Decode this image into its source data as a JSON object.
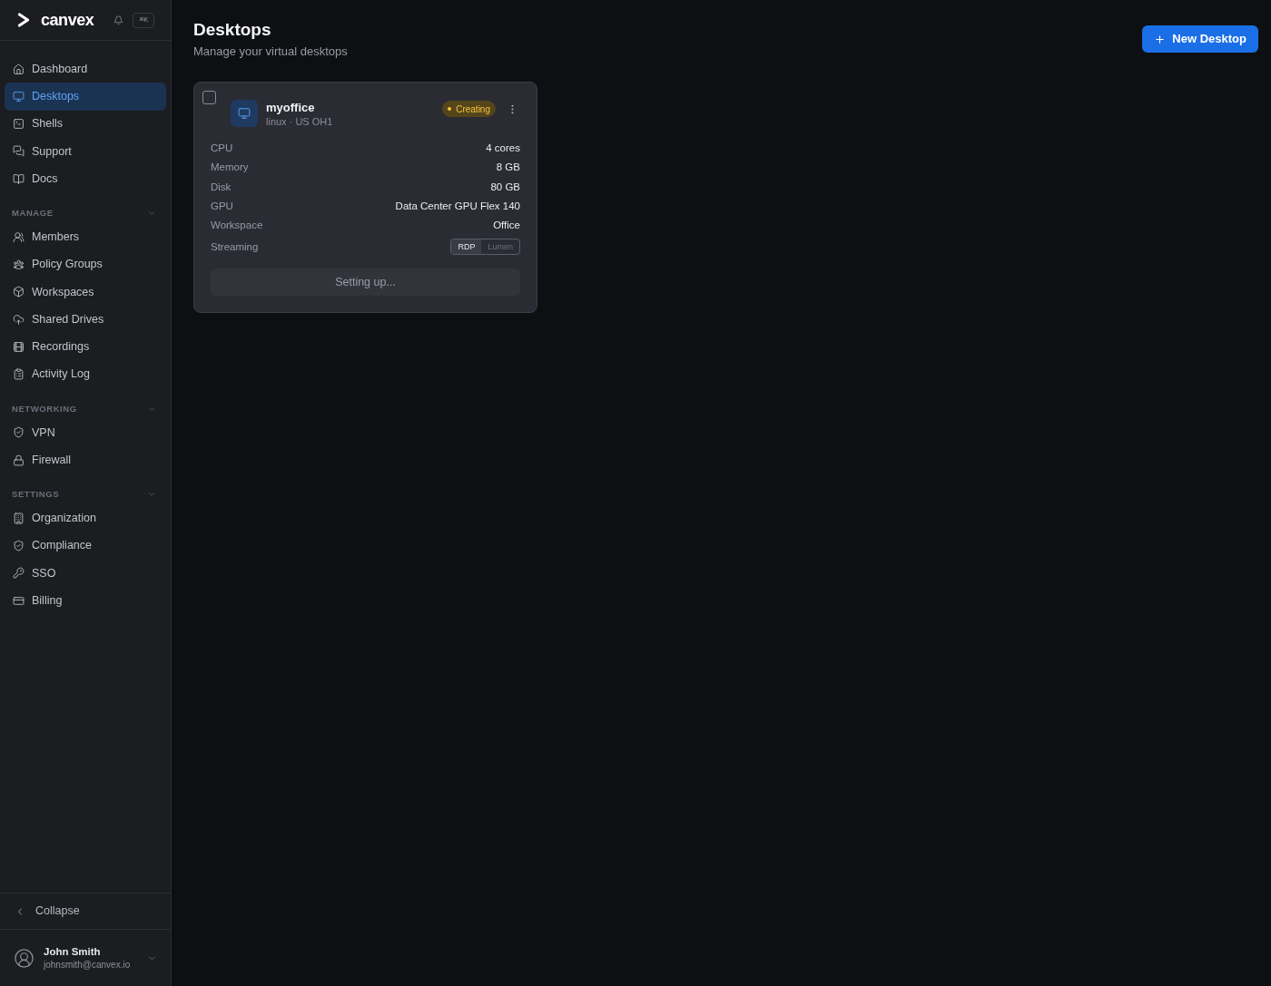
{
  "sidebar": {
    "logo": "canvex",
    "shortcut": "⌘K",
    "nav": [
      {
        "label": "Dashboard",
        "selected": false
      },
      {
        "label": "Desktops",
        "selected": true
      },
      {
        "label": "Shells",
        "selected": false
      },
      {
        "label": "Support",
        "selected": false
      },
      {
        "label": "Docs",
        "selected": false
      }
    ],
    "sections": [
      {
        "title": "MANAGE",
        "expanded": true,
        "items": [
          {
            "label": "Members",
            "selected": false
          },
          {
            "label": "Policy Groups",
            "selected": false
          },
          {
            "label": "Workspaces",
            "selected": false
          },
          {
            "label": "Shared Drives",
            "selected": false
          },
          {
            "label": "Recordings",
            "selected": false
          },
          {
            "label": "Activity Log",
            "selected": false
          }
        ]
      },
      {
        "title": "NETWORKING",
        "expanded": true,
        "items": [
          {
            "label": "VPN",
            "selected": false
          },
          {
            "label": "Firewall",
            "selected": false
          }
        ]
      },
      {
        "title": "SETTINGS",
        "expanded": true,
        "items": [
          {
            "label": "Organization",
            "selected": false
          },
          {
            "label": "Compliance",
            "selected": false
          },
          {
            "label": "SSO",
            "selected": false
          },
          {
            "label": "Billing",
            "selected": false
          }
        ]
      }
    ],
    "collapse": "Collapse",
    "user": {
      "name": "John Smith",
      "email": "johnsmith@canvex.io"
    }
  },
  "header": {
    "title": "Desktops",
    "subtitle": "Manage your virtual desktops",
    "button": "New Desktop"
  },
  "desktops": [
    {
      "checked": false,
      "name": "myoffice",
      "subtitle": "linux · US OH1",
      "status": {
        "kind": "pending",
        "label": "Creating"
      },
      "specs": [
        {
          "label": "CPU",
          "value": "4 cores"
        },
        {
          "label": "Memory",
          "value": "8 GB"
        },
        {
          "label": "Disk",
          "value": "80 GB"
        },
        {
          "label": "GPU",
          "value": "Data Center GPU Flex 140"
        },
        {
          "label": "Workspace",
          "value": "Office"
        }
      ],
      "streaming": {
        "label": "Streaming",
        "options": [
          {
            "label": "RDP",
            "selected": true
          },
          {
            "label": "Lumen",
            "selected": false
          }
        ]
      },
      "action": {
        "label": "Setting up...",
        "disabled": true
      }
    }
  ]
}
